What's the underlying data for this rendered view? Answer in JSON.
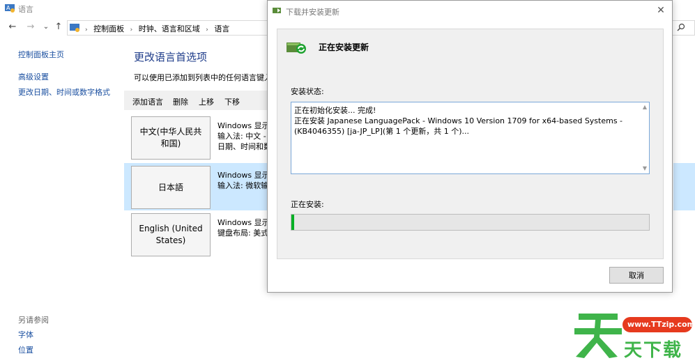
{
  "window": {
    "title": "语言"
  },
  "address": {
    "nav": {
      "back": "←",
      "forward": "→",
      "recent": "⌄",
      "up": "↑"
    },
    "breadcrumbs": [
      "控制面板",
      "时钟、语言和区域",
      "语言"
    ]
  },
  "sidebar": {
    "links": [
      "控制面板主页",
      "高级设置",
      "更改日期、时间或数字格式"
    ],
    "see_also": "另请参阅",
    "see_also_links": [
      "字体",
      "位置"
    ]
  },
  "main": {
    "title": "更改语言首选项",
    "description": "可以使用已添加到列表中的任何语言键入",
    "toolbar": [
      "添加语言",
      "删除",
      "上移",
      "下移"
    ],
    "languages": [
      {
        "name": "中文(中华人民共和国)",
        "lines": [
          "Windows 显示语言",
          "输入法: 中文 - ",
          "日期、时间和数字格式"
        ],
        "selected": false
      },
      {
        "name": "日本語",
        "lines": [
          "Windows 显示语言",
          "输入法: 微软输入法"
        ],
        "selected": true
      },
      {
        "name": "English (United States)",
        "lines": [
          "Windows 显示语言",
          "键盘布局: 美式键盘"
        ],
        "selected": false
      }
    ]
  },
  "dialog": {
    "title": "下载并安装更新",
    "close": "✕",
    "header": "正在安装更新",
    "status_label": "安装状态:",
    "status_text": "正在初始化安装... 完成!\n正在安装 Japanese LanguagePack - Windows 10 Version 1709 for x64-based Systems - (KB4046355) [ja-JP_LP](第 1 个更新，共 1 个)...",
    "installing_label": "正在安装:",
    "progress": 0.008,
    "cancel_label": "取消"
  },
  "watermark": {
    "url": "www.TTzip.com",
    "text": "天下载"
  },
  "colors": {
    "accent": "#1a4fa0",
    "selection": "#cce8ff",
    "progress": "#06b025",
    "watermark_green": "#3fb44a",
    "watermark_red": "#e63a1e"
  }
}
